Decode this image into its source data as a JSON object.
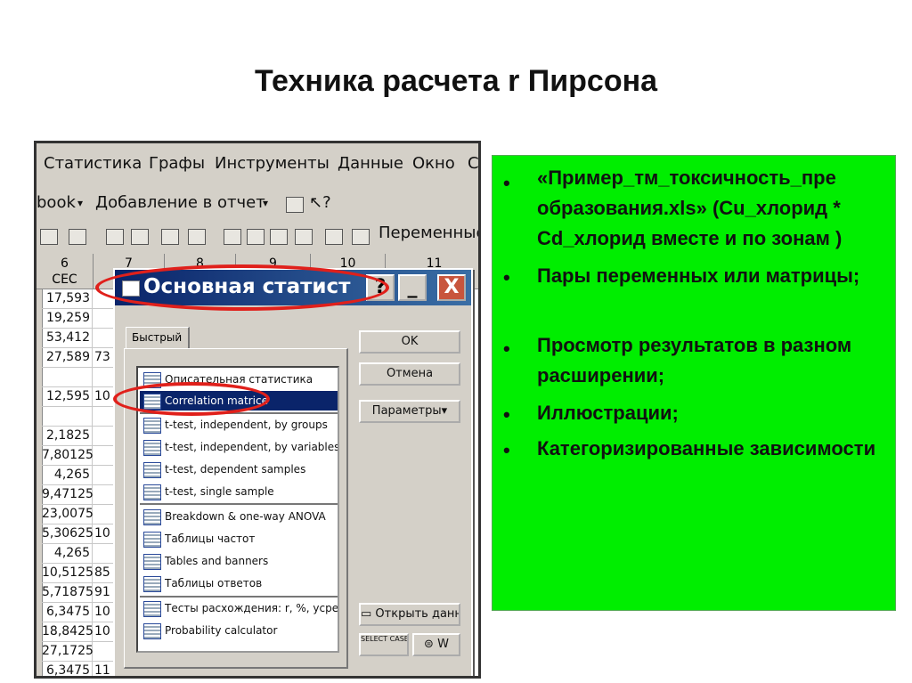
{
  "slide": {
    "title": "Техника расчета r Пирсона"
  },
  "app": {
    "menu": [
      "Статистика",
      "Графы",
      "Инструменты",
      "Данные",
      "Окно",
      "С"
    ],
    "toolbar1": {
      "book": "book",
      "add_report": "Добавление в отчет"
    },
    "toolbar2": {
      "variables": "Переменные"
    },
    "columns": [
      {
        "num": "6",
        "name": "CEC"
      },
      {
        "num": "7",
        "name": ""
      },
      {
        "num": "8",
        "name": ""
      },
      {
        "num": "9",
        "name": ""
      },
      {
        "num": "10",
        "name": ""
      },
      {
        "num": "11",
        "name": ""
      }
    ],
    "rows": [
      {
        "a": "17,593",
        "b": ""
      },
      {
        "a": "19,259",
        "b": ""
      },
      {
        "a": "53,412",
        "b": ""
      },
      {
        "a": "27,589",
        "b": "73"
      },
      {
        "a": "",
        "b": ""
      },
      {
        "a": "12,595",
        "b": "10"
      },
      {
        "a": "",
        "b": ""
      },
      {
        "a": "2,1825",
        "b": ""
      },
      {
        "a": "7,80125",
        "b": ""
      },
      {
        "a": "4,265",
        "b": ""
      },
      {
        "a": "9,47125",
        "b": ""
      },
      {
        "a": "23,0075",
        "b": ""
      },
      {
        "a": "5,30625",
        "b": "10"
      },
      {
        "a": "4,265",
        "b": ""
      },
      {
        "a": "10,5125",
        "b": "85"
      },
      {
        "a": "5,71875",
        "b": "91"
      },
      {
        "a": "6,3475",
        "b": "10"
      },
      {
        "a": "18,8425",
        "b": "10"
      },
      {
        "a": "27,1725",
        "b": ""
      },
      {
        "a": "6,3475",
        "b": "11"
      }
    ]
  },
  "dialog": {
    "title": "Основная статист",
    "help": "?",
    "minimize": "_",
    "close": "X",
    "tab": "Быстрый",
    "items": [
      "Описательная статистика",
      "Correlation matrice",
      "t-test, independent, by groups",
      "t-test, independent, by variables",
      "t-test, dependent samples",
      "t-test, single sample",
      "Breakdown & one-way ANOVA",
      "Таблицы частот",
      "Tables and banners",
      "Таблицы ответов",
      "Тесты расхождения: r, %, усре",
      "Probability calculator"
    ],
    "selected_index": 1,
    "buttons": {
      "ok": "OK",
      "cancel": "Отмена",
      "params": "Параметры",
      "open_data": "Открыть данн",
      "select_cases": "SELECT CASES",
      "s": "S",
      "w": "W"
    }
  },
  "bullets": [
    "«Пример_тм_токсичность_пре образования.xls» (Cu_хлорид * Cd_хлорид вместе и по зонам )",
    "Пары переменных или матрицы;",
    "Просмотр результатов в разном расширении;",
    "Иллюстрации;",
    "Категоризированные зависимости"
  ],
  "colors": {
    "highlight": "#00ee00",
    "annotation": "#e0201b",
    "titlebar": "#0a246a"
  }
}
